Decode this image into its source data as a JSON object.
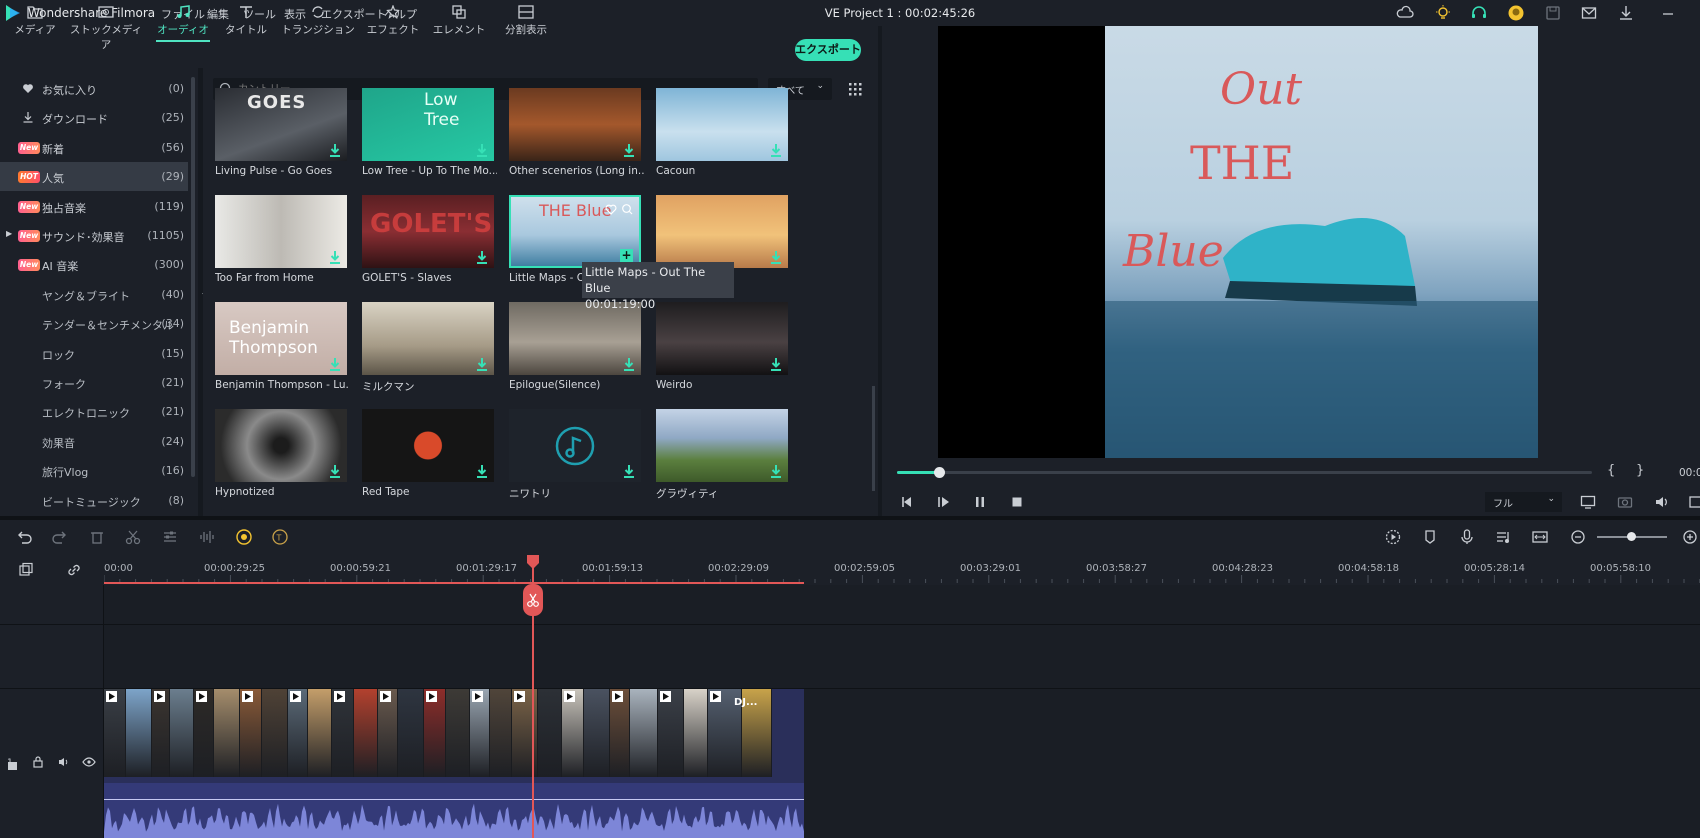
{
  "app": {
    "name": "Wondershare Filmora",
    "project_title": "VE Project 1 : 00:02:45:26"
  },
  "menu": [
    "ファイル",
    "編集",
    "ツール",
    "表示",
    "エクスポート",
    "ヘルプ"
  ],
  "tabs": [
    {
      "label": "メディア",
      "icon": "folder-icon"
    },
    {
      "label": "ストックメディア",
      "icon": "stock-media-icon"
    },
    {
      "label": "オーディオ",
      "icon": "music-note-icon",
      "active": true
    },
    {
      "label": "タイトル",
      "icon": "title-t-icon"
    },
    {
      "label": "トランジション",
      "icon": "transition-icon"
    },
    {
      "label": "エフェクト",
      "icon": "effect-icon"
    },
    {
      "label": "エレメント",
      "icon": "element-icon"
    },
    {
      "label": "分割表示",
      "icon": "split-screen-icon"
    }
  ],
  "export_label": "エクスポート",
  "sidebar": [
    {
      "label": "お気に入り",
      "count": "(0)",
      "icon": "heart-icon"
    },
    {
      "label": "ダウンロード",
      "count": "(25)",
      "icon": "download-icon"
    },
    {
      "label": "新着",
      "count": "(56)",
      "badge": "New"
    },
    {
      "label": "人気",
      "count": "(29)",
      "badge": "HOT",
      "active": true
    },
    {
      "label": "独占音楽",
      "count": "(119)",
      "badge": "New"
    },
    {
      "label": "サウンド･効果音",
      "count": "(1105)",
      "badge": "New",
      "expand": true
    },
    {
      "label": "AI 音楽",
      "count": "(300)",
      "badge": "New"
    },
    {
      "label": "ヤング＆ブライト",
      "count": "(40)",
      "sub": true
    },
    {
      "label": "テンダー＆センチメンタル",
      "count": "(34)",
      "sub": true
    },
    {
      "label": "ロック",
      "count": "(15)",
      "sub": true
    },
    {
      "label": "フォーク",
      "count": "(21)",
      "sub": true
    },
    {
      "label": "エレクトロニック",
      "count": "(21)",
      "sub": true
    },
    {
      "label": "効果音",
      "count": "(24)",
      "sub": true
    },
    {
      "label": "旅行Vlog",
      "count": "(16)",
      "sub": true
    },
    {
      "label": "ビートミュージック",
      "count": "(8)",
      "sub": true
    }
  ],
  "search": {
    "placeholder": "カントリー",
    "filter": "すべて"
  },
  "thumbs": [
    {
      "label": "Living Pulse - Go Goes",
      "art": "GOES"
    },
    {
      "label": "Low Tree - Up To The Mo...",
      "art": "Low Tree"
    },
    {
      "label": "Other scenerios  (Long in...",
      "art": ""
    },
    {
      "label": "Cacoun",
      "art": ""
    },
    {
      "label": "Too Far from Home",
      "art": ""
    },
    {
      "label": "GOLET'S - Slaves",
      "art": "GOLET'S"
    },
    {
      "label": "Little Maps - Ou",
      "art": "THE Blue"
    },
    {
      "label": "To the L...",
      "art": ""
    },
    {
      "label": "Benjamin Thompson - Lu...",
      "art": "Benjamin Thompson"
    },
    {
      "label": "ミルクマン",
      "art": ""
    },
    {
      "label": "Epilogue(Silence)",
      "art": ""
    },
    {
      "label": "Weirdo",
      "art": ""
    },
    {
      "label": "Hypnotized",
      "art": ""
    },
    {
      "label": "Red Tape",
      "art": ""
    },
    {
      "label": "ニワトリ",
      "art": ""
    },
    {
      "label": "グラヴィティ",
      "art": ""
    }
  ],
  "tooltip": {
    "title": "Little Maps - Out The Blue",
    "time": "00:01:19:00"
  },
  "preview": {
    "art_top": "Out",
    "art_mid": "THE",
    "art_bot": "Blue",
    "progress": 0.06,
    "timecode": "00:0",
    "quality": "フル",
    "mark_in": "{",
    "mark_out": "}"
  },
  "ruler": [
    "00:00",
    "00:00:29:25",
    "00:00:59:21",
    "00:01:29:17",
    "00:01:59:13",
    "00:02:29:09",
    "00:02:59:05",
    "00:03:29:01",
    "00:03:58:27",
    "00:04:28:23",
    "00:04:58:18",
    "00:05:28:14",
    "00:05:58:10"
  ],
  "clip_label": "DJ...",
  "track_number": "1",
  "colors": {
    "accent": "#36e0b6",
    "playhead": "#e25757"
  }
}
